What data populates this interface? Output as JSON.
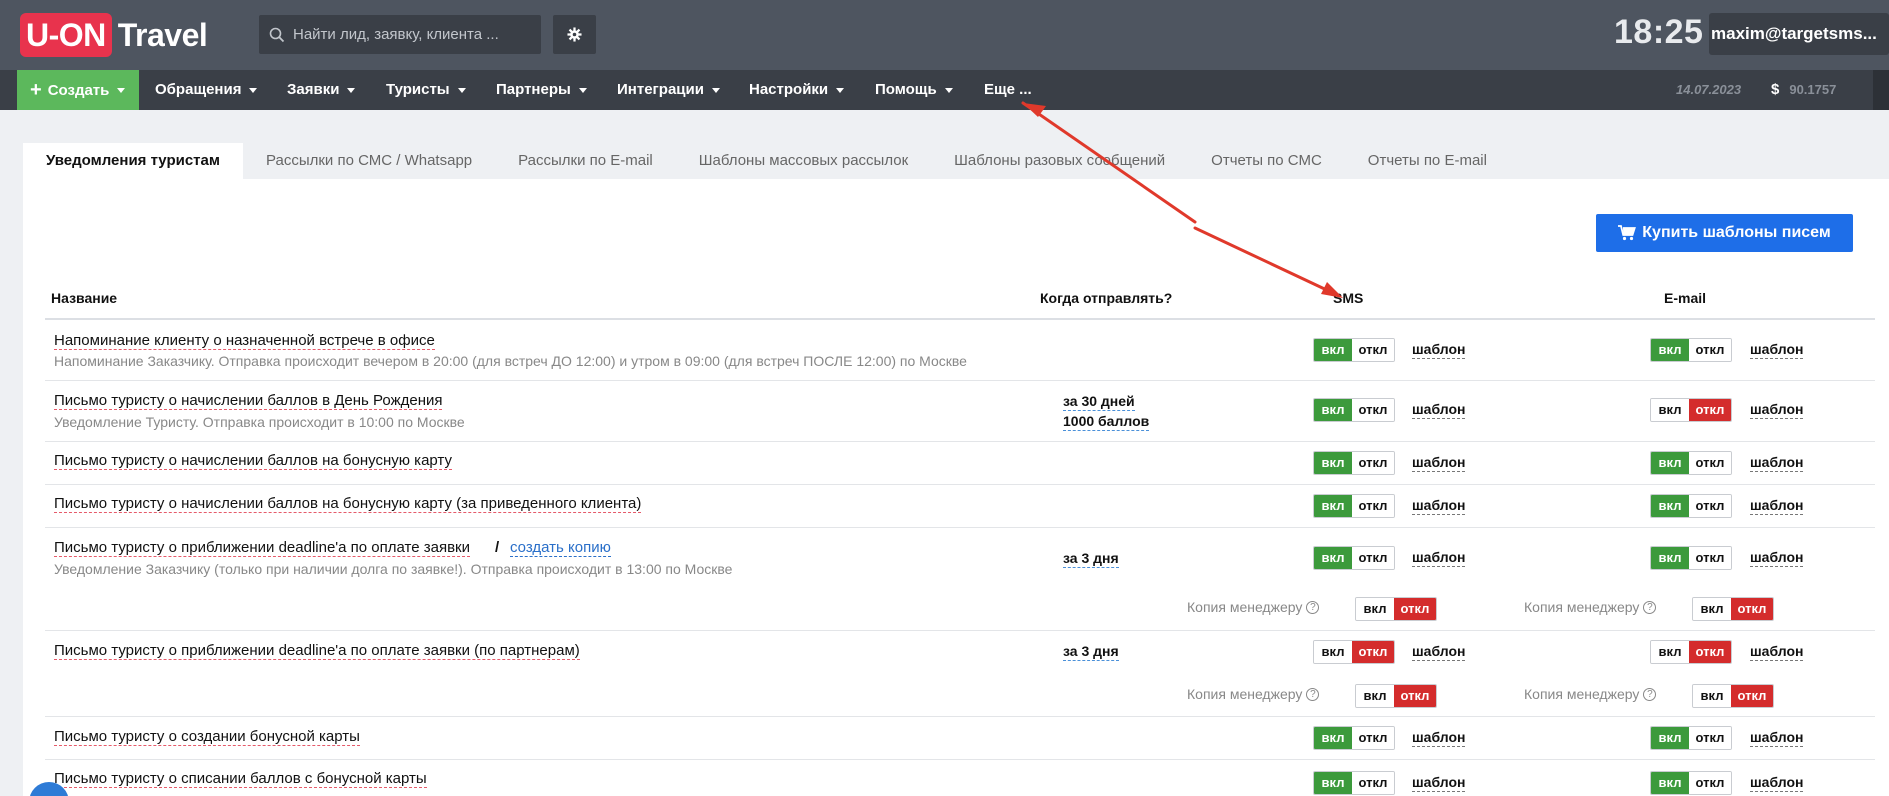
{
  "brand": {
    "logo_box": "U-ON",
    "logo_text": "Travel"
  },
  "search": {
    "placeholder": "Найти лид, заявку, клиента ..."
  },
  "clock": "18:25",
  "user": "maxim@targetsms...",
  "menu": {
    "create": "Создать",
    "items": [
      "Обращения",
      "Заявки",
      "Туристы",
      "Партнеры",
      "Интеграции",
      "Настройки",
      "Помощь",
      "Еще ..."
    ],
    "date": "14.07.2023",
    "currency_icon": "$",
    "balance": "90.1757"
  },
  "tabs": [
    "Уведомления туристам",
    "Рассылки по СМС / Whatsapp",
    "Рассылки по E-mail",
    "Шаблоны массовых рассылок",
    "Шаблоны разовых сообщений",
    "Отчеты по СМС",
    "Отчеты по E-mail"
  ],
  "buy_button": "Купить шаблоны писем",
  "table": {
    "headers": {
      "name": "Название",
      "when": "Когда отправлять?",
      "sms": "SMS",
      "email": "E-mail"
    },
    "labels": {
      "on": "вкл",
      "off": "откл",
      "template": "шаблон",
      "manager_copy": "Копия менеджеру",
      "create_copy": "создать копию",
      "sep": "/"
    },
    "rows": [
      {
        "title": "Напоминание клиенту о назначенной встрече в офисе",
        "desc": "Напоминание Заказчику. Отправка происходит вечером в 20:00 (для встреч ДО 12:00) и утром в 09:00 (для встреч ПОСЛЕ 12:00) по Москве",
        "when": [],
        "sms": "on",
        "email": "on"
      },
      {
        "title": "Письмо туристу о начислении баллов в День Рождения",
        "desc": "Уведомление Туристу. Отправка происходит в 10:00 по Москве",
        "when": [
          "за 30 дней",
          "1000 баллов"
        ],
        "sms": "on",
        "email": "off"
      },
      {
        "title": "Письмо туристу о начислении баллов на бонусную карту",
        "desc": "",
        "when": [],
        "sms": "on",
        "email": "on"
      },
      {
        "title": "Письмо туристу о начислении баллов на бонусную карту (за приведенного клиента)",
        "desc": "",
        "when": [],
        "sms": "on",
        "email": "on"
      },
      {
        "title": "Письмо туристу о приближении deadline'а по оплате заявки",
        "desc": "Уведомление Заказчику (только при наличии долга по заявке!). Отправка происходит в 13:00 по Москве",
        "when": [
          "за 3 дня"
        ],
        "sms": "on",
        "email": "on",
        "manager_sms": "off",
        "manager_email": "off"
      },
      {
        "title": "Письмо туристу о приближении deadline'а по оплате заявки (по партнерам)",
        "desc": "",
        "when": [
          "за 3 дня"
        ],
        "sms": "off",
        "email": "off",
        "manager_sms": "off",
        "manager_email": "off"
      },
      {
        "title": "Письмо туристу о создании бонусной карты",
        "desc": "",
        "when": [],
        "sms": "on",
        "email": "on"
      },
      {
        "title": "Письмо туристу о списании баллов с бонусной карты",
        "desc": "",
        "when": [],
        "sms": "on",
        "email": "on"
      }
    ]
  },
  "colors": {
    "brand_red": "#e8334d",
    "topbar": "#4e5560",
    "menubar": "#3a3f47",
    "create_green": "#5cb85c",
    "toggle_on": "#3c9a3c",
    "toggle_off": "#d42c2c",
    "buy_blue": "#1e6ee8",
    "arrow": "#e0392b"
  },
  "icons": {
    "search": "search-icon",
    "settings": "gear-icon",
    "cart": "cart-icon",
    "chat": "chat-icon",
    "help": "question-icon"
  }
}
